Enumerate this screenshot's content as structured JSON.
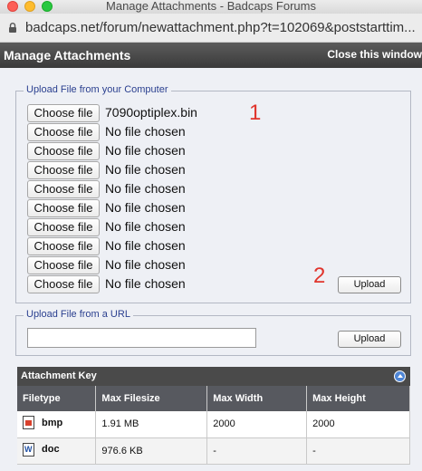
{
  "window": {
    "title": "Manage Attachments - Badcaps Forums"
  },
  "browser": {
    "url": "badcaps.net/forum/newattachment.php?t=102069&poststarttim..."
  },
  "header": {
    "title": "Manage Attachments",
    "close_label": "Close this window"
  },
  "upload_computer": {
    "legend": "Upload File from your Computer",
    "choose_label": "Choose file",
    "files": [
      "7090optiplex.bin",
      "No file chosen",
      "No file chosen",
      "No file chosen",
      "No file chosen",
      "No file chosen",
      "No file chosen",
      "No file chosen",
      "No file chosen",
      "No file chosen"
    ],
    "upload_label": "Upload"
  },
  "annotations": {
    "one": "1",
    "two": "2"
  },
  "upload_url": {
    "legend": "Upload File from a URL",
    "value": "",
    "upload_label": "Upload"
  },
  "attachment_key": {
    "title": "Attachment Key",
    "columns": [
      "Filetype",
      "Max Filesize",
      "Max Width",
      "Max Height"
    ],
    "rows": [
      {
        "type": "bmp",
        "icon": "bmp-file-icon",
        "size": "1.91 MB",
        "width": "2000",
        "height": "2000"
      },
      {
        "type": "doc",
        "icon": "doc-file-icon",
        "size": "976.6 KB",
        "width": "-",
        "height": "-"
      }
    ]
  }
}
